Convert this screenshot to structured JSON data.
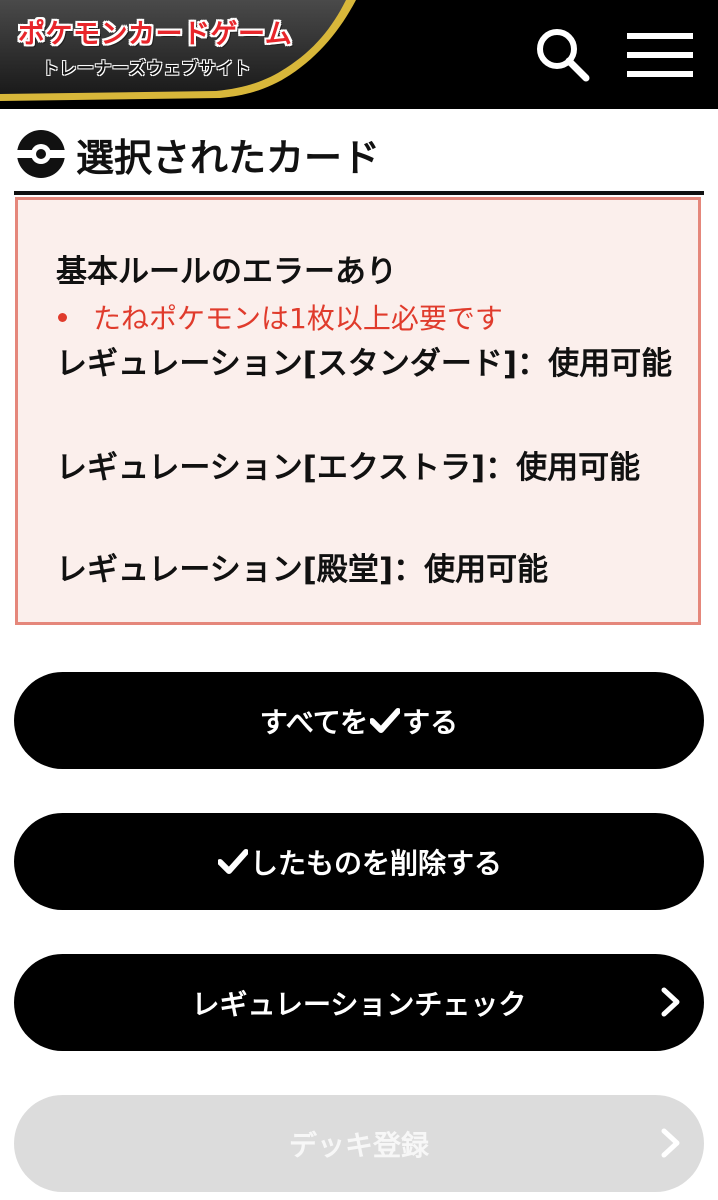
{
  "header": {
    "logo_main": "ポケモンカードゲーム",
    "logo_sub": "トレーナーズウェブサイト",
    "icons": {
      "search": "search-icon",
      "menu": "hamburger-menu-icon"
    }
  },
  "section": {
    "title": "選択されたカード",
    "icon": "pokeball-icon"
  },
  "errors": {
    "heading": "基本ルールのエラーあり",
    "bullet": "たねポケモンは1枚以上必要です",
    "regulations": [
      "レギュレーション[スタンダード]：使用可能",
      "レギュレーション[エクストラ]：使用可能",
      "レギュレーション[殿堂]：使用可能"
    ]
  },
  "buttons": {
    "select_all_pre": "すべてを",
    "select_all_post": "する",
    "delete_checked": "したものを削除する",
    "regulation_check": "レギュレーションチェック",
    "deck_register": "デッキ登録"
  },
  "colors": {
    "error_border": "#e5877b",
    "error_bg": "#fbefec",
    "error_text": "#e03b2c",
    "button": "#000000",
    "button_disabled": "#dcdcdc",
    "logo_gold": "#d8b73a"
  }
}
